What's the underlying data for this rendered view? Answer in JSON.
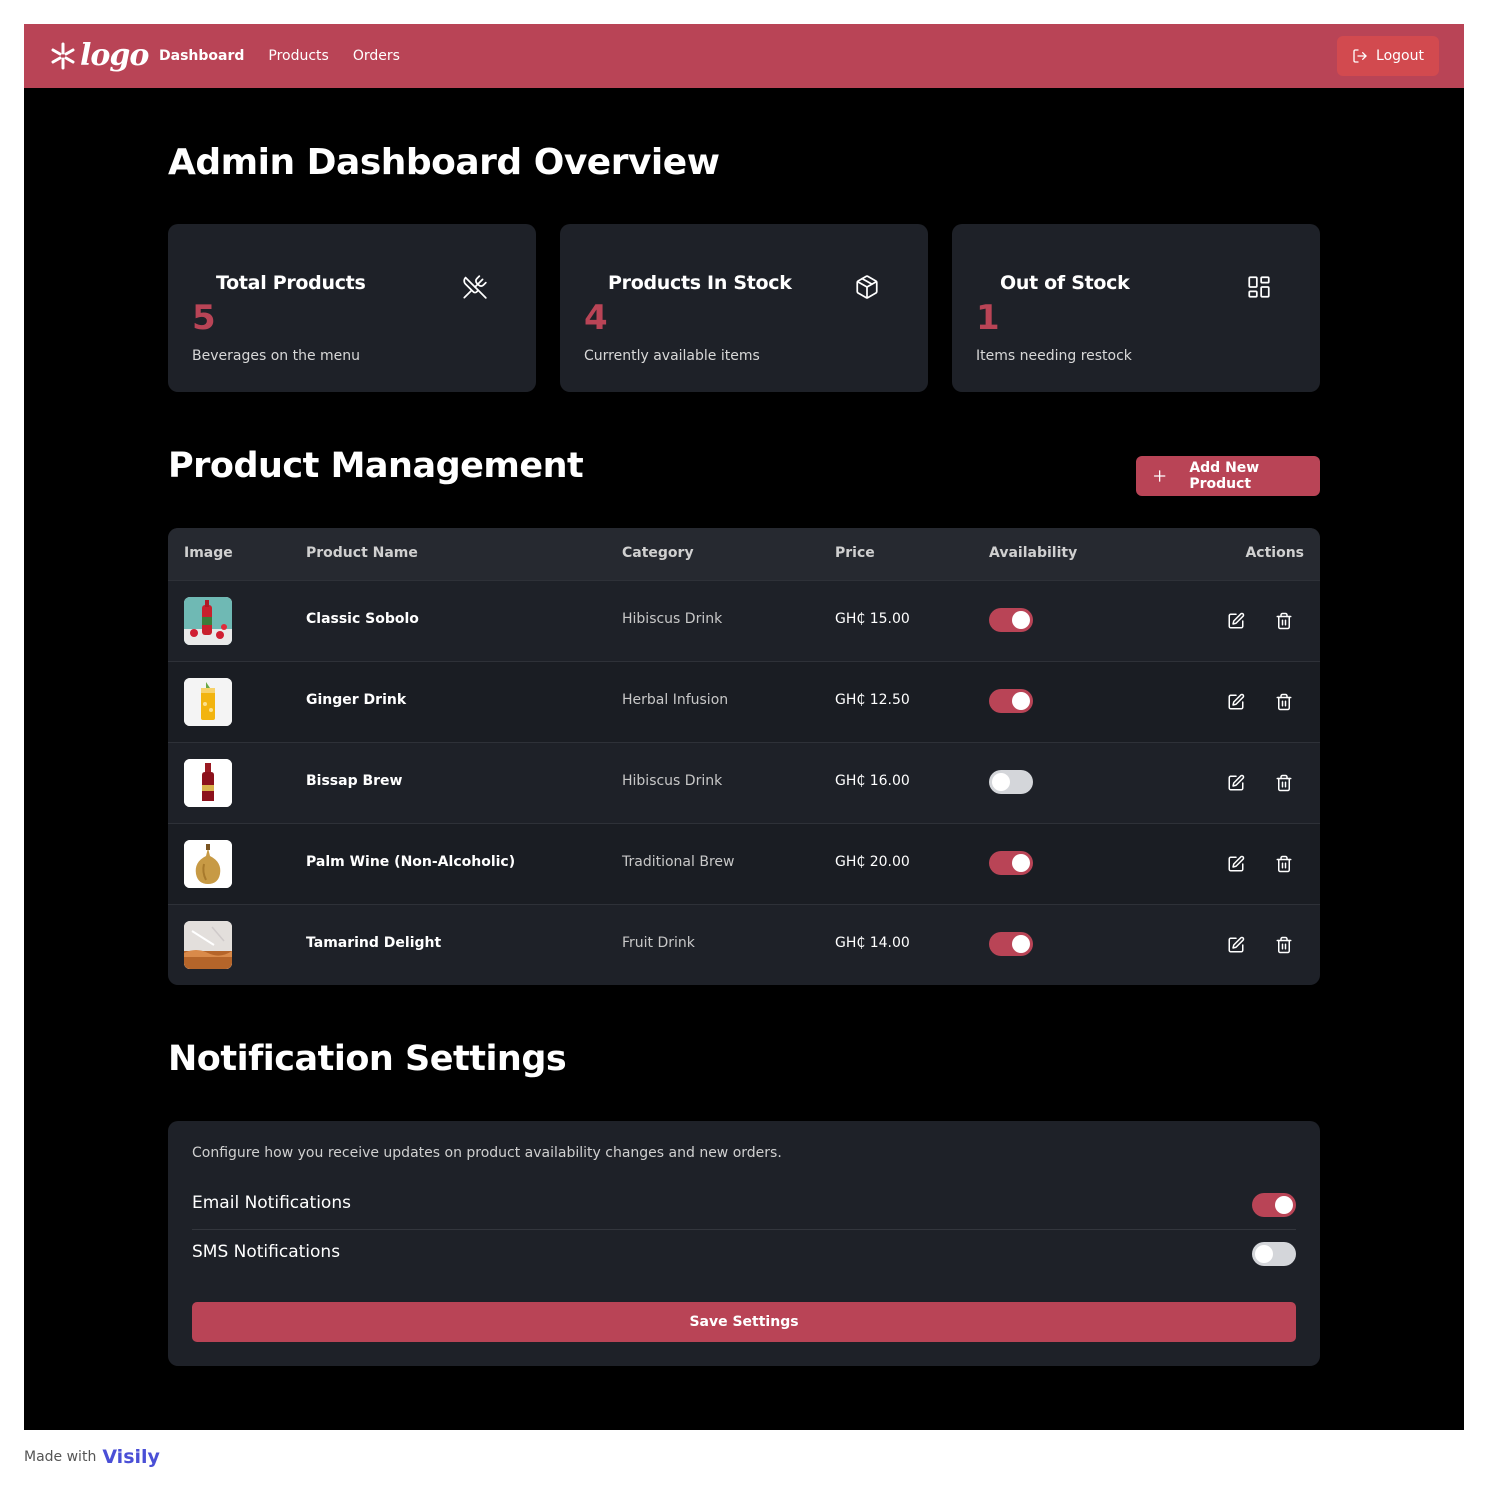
{
  "nav": {
    "logo_text": "logo",
    "links": [
      {
        "label": "Dashboard"
      },
      {
        "label": "Products"
      },
      {
        "label": "Orders"
      }
    ],
    "logout_label": "Logout"
  },
  "overview": {
    "title": "Admin Dashboard Overview",
    "stats": [
      {
        "title": "Total Products",
        "value": "5",
        "desc": "Beverages on the menu",
        "icon": "utensils-crossed-icon"
      },
      {
        "title": "Products In Stock",
        "value": "4",
        "desc": "Currently available items",
        "icon": "package-icon"
      },
      {
        "title": "Out of Stock",
        "value": "1",
        "desc": "Items needing restock",
        "icon": "grid-icon"
      }
    ]
  },
  "products": {
    "title": "Product Management",
    "add_label": "Add New Product",
    "columns": [
      "Image",
      "Product Name",
      "Category",
      "Price",
      "Availability",
      "Actions"
    ],
    "rows": [
      {
        "name": "Classic Sobolo",
        "category": "Hibiscus Drink",
        "price": "GH₵ 15.00",
        "available": true
      },
      {
        "name": "Ginger Drink",
        "category": "Herbal Infusion",
        "price": "GH₵ 12.50",
        "available": true
      },
      {
        "name": "Bissap Brew",
        "category": "Hibiscus Drink",
        "price": "GH₵ 16.00",
        "available": false
      },
      {
        "name": "Palm Wine (Non-Alcoholic)",
        "category": "Traditional Brew",
        "price": "GH₵ 20.00",
        "available": true
      },
      {
        "name": "Tamarind Delight",
        "category": "Fruit Drink",
        "price": "GH₵ 14.00",
        "available": true
      }
    ]
  },
  "notifications": {
    "title": "Notification Settings",
    "description": "Configure how you receive updates on product availability changes and new orders.",
    "email_label": "Email Notifications",
    "email_on": true,
    "sms_label": "SMS Notifications",
    "sms_on": false,
    "save_label": "Save Settings"
  },
  "footer": {
    "made_with": "Made with",
    "brand": "Visily"
  },
  "colors": {
    "accent": "#b94456",
    "logout": "#d24a4f",
    "card": "#1e2128",
    "background": "#000000"
  }
}
